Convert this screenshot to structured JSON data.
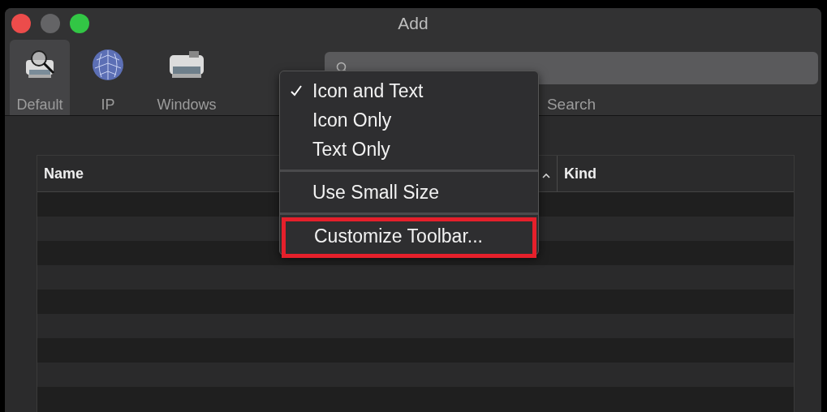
{
  "window": {
    "title": "Add"
  },
  "toolbar": {
    "items": [
      {
        "label": "Default",
        "kind": "default",
        "selected": true
      },
      {
        "label": "IP",
        "kind": "ip",
        "selected": false
      },
      {
        "label": "Windows",
        "kind": "windows",
        "selected": false
      }
    ],
    "search_label": "Search"
  },
  "table": {
    "columns": [
      {
        "label": "Name",
        "sorted": true
      },
      {
        "label": "Kind",
        "sorted": false
      }
    ]
  },
  "menu": {
    "groups": [
      [
        {
          "label": "Icon and Text",
          "checked": true,
          "annotated": false
        },
        {
          "label": "Icon Only",
          "checked": false,
          "annotated": false
        },
        {
          "label": "Text Only",
          "checked": false,
          "annotated": false
        }
      ],
      [
        {
          "label": "Use Small Size",
          "checked": false,
          "annotated": false
        }
      ],
      [
        {
          "label": "Customize Toolbar...",
          "checked": false,
          "annotated": true
        }
      ]
    ]
  }
}
